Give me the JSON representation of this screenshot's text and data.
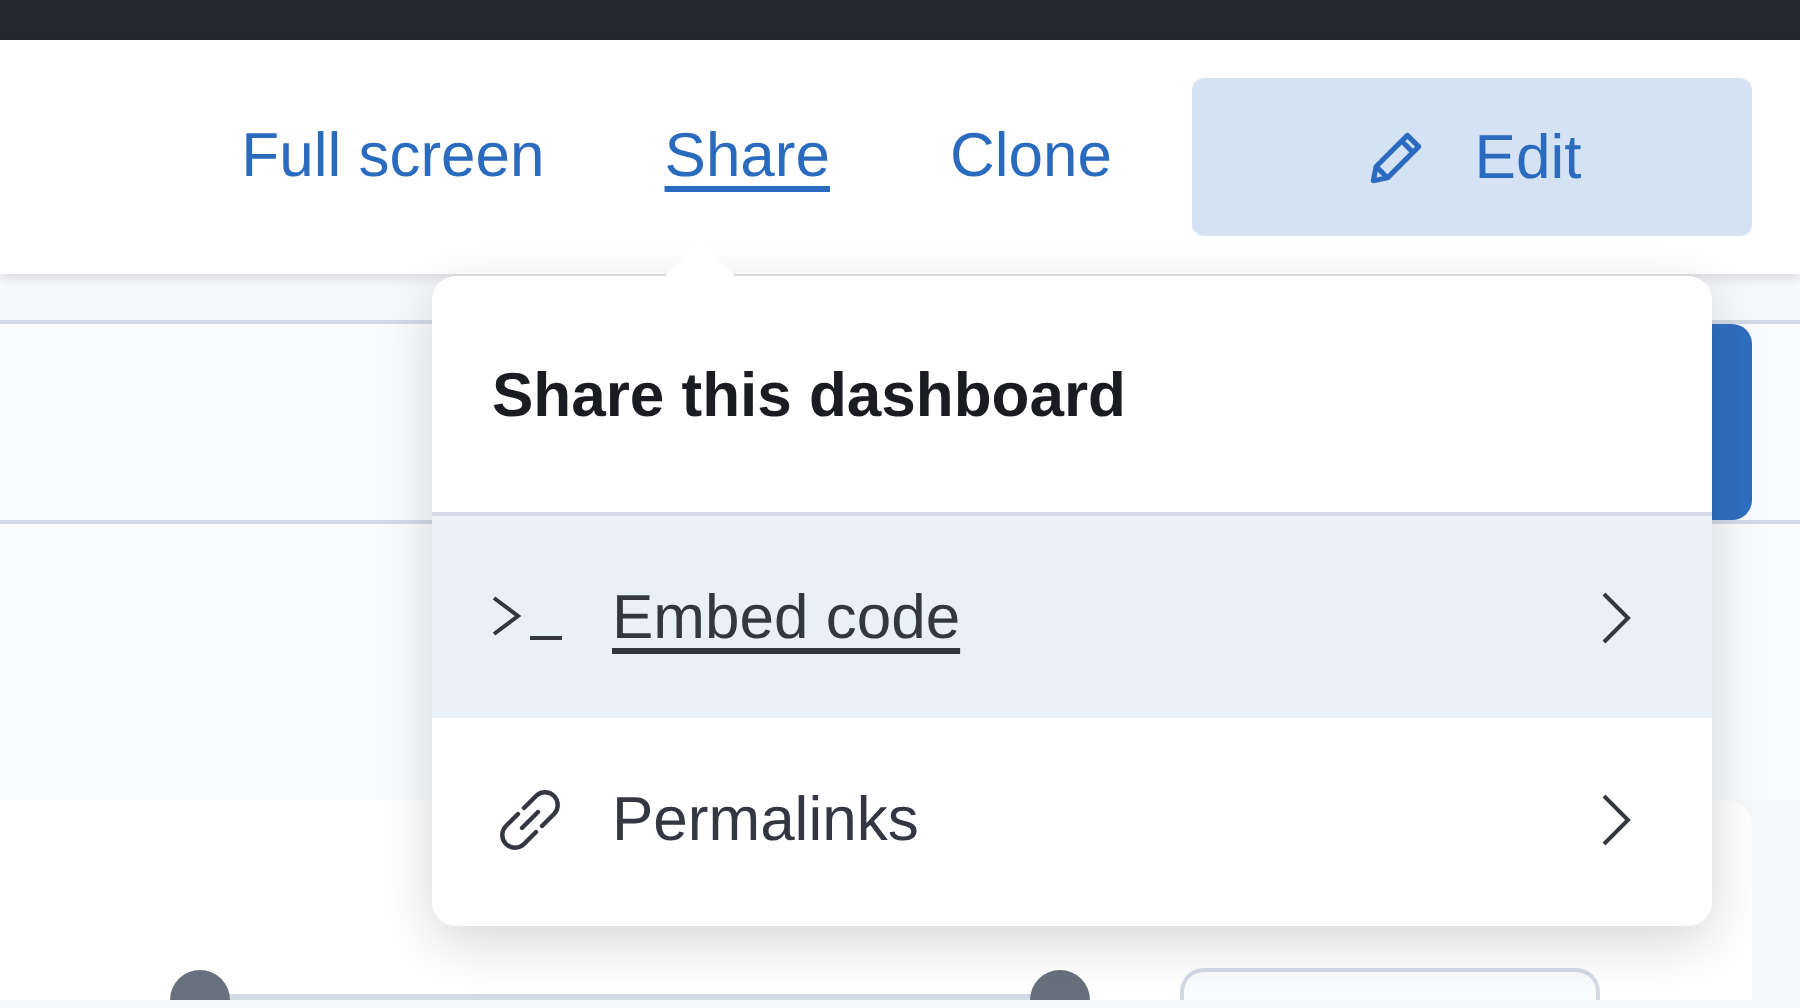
{
  "header": {
    "links": [
      {
        "label": "Full screen",
        "selected": false
      },
      {
        "label": "Share",
        "selected": true
      },
      {
        "label": "Clone",
        "selected": false
      }
    ],
    "edit_button": {
      "label": "Edit"
    }
  },
  "range_slider": {
    "thumbs": [
      {
        "level": 0
      },
      {
        "level": 1
      }
    ]
  },
  "share_menu": {
    "title": "Share this dashboard",
    "items": [
      {
        "kind": "code",
        "label": "Embed code",
        "selected": true
      },
      {
        "kind": "link",
        "label": "Permalinks",
        "selected": false
      }
    ]
  }
}
